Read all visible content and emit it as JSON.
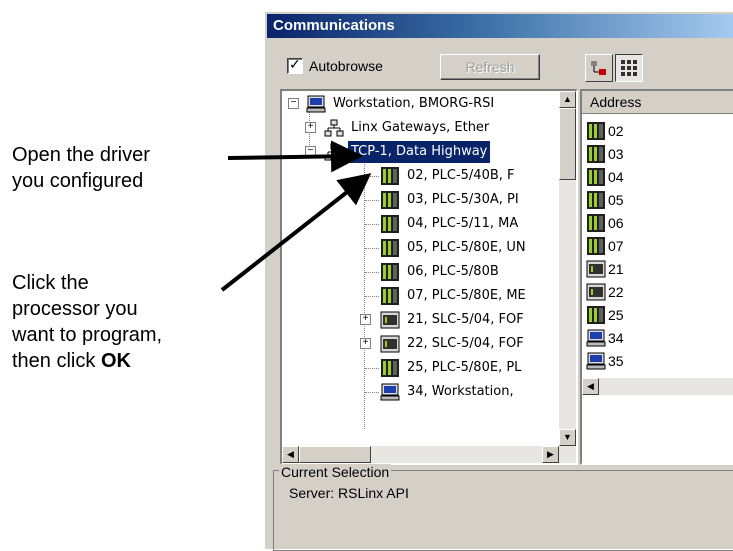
{
  "annotations": {
    "open_driver": [
      "Open the driver",
      "you configured"
    ],
    "click_processor": [
      "Click the",
      "processor you",
      "want to program,"
    ],
    "then_click": "then click ",
    "ok": "OK"
  },
  "window": {
    "title": "Communications",
    "autobrowse_label": "Autobrowse",
    "autobrowse_checked": "✓",
    "refresh_label": "Refresh"
  },
  "tree": {
    "root": "Workstation, BMORG-RSI",
    "linx": "Linx Gateways, Ether",
    "driver": "TCP-1, Data Highway",
    "devices": [
      {
        "label": "02, PLC-5/40B,   F",
        "icon": "plc5-icon"
      },
      {
        "label": "03, PLC-5/30A, PI",
        "icon": "plc5-icon"
      },
      {
        "label": "04, PLC-5/11, MA",
        "icon": "plc5-icon"
      },
      {
        "label": "05, PLC-5/80E, UN",
        "icon": "plc5-icon"
      },
      {
        "label": "06, PLC-5/80B",
        "icon": "plc5-icon"
      },
      {
        "label": "07, PLC-5/80E, ME",
        "icon": "plc5-icon"
      },
      {
        "label": "21, SLC-5/04, FOF",
        "icon": "slc-icon"
      },
      {
        "label": "22, SLC-5/04, FOF",
        "icon": "slc-icon"
      },
      {
        "label": "25, PLC-5/80E, PL",
        "icon": "plc5-icon"
      },
      {
        "label": "34, Workstation, ",
        "icon": "workstation-icon"
      }
    ]
  },
  "address_panel": {
    "header": "Address",
    "rows": [
      "02",
      "03",
      "04",
      "05",
      "06",
      "07",
      "21",
      "22",
      "25",
      "34",
      "35"
    ]
  },
  "current_selection": {
    "label": "Current Selection",
    "value": "Server: RSLinx API"
  },
  "colors": {
    "selection": "#0a246a",
    "window_bg": "#d4d0c8",
    "plc_green": "#9acd32"
  }
}
